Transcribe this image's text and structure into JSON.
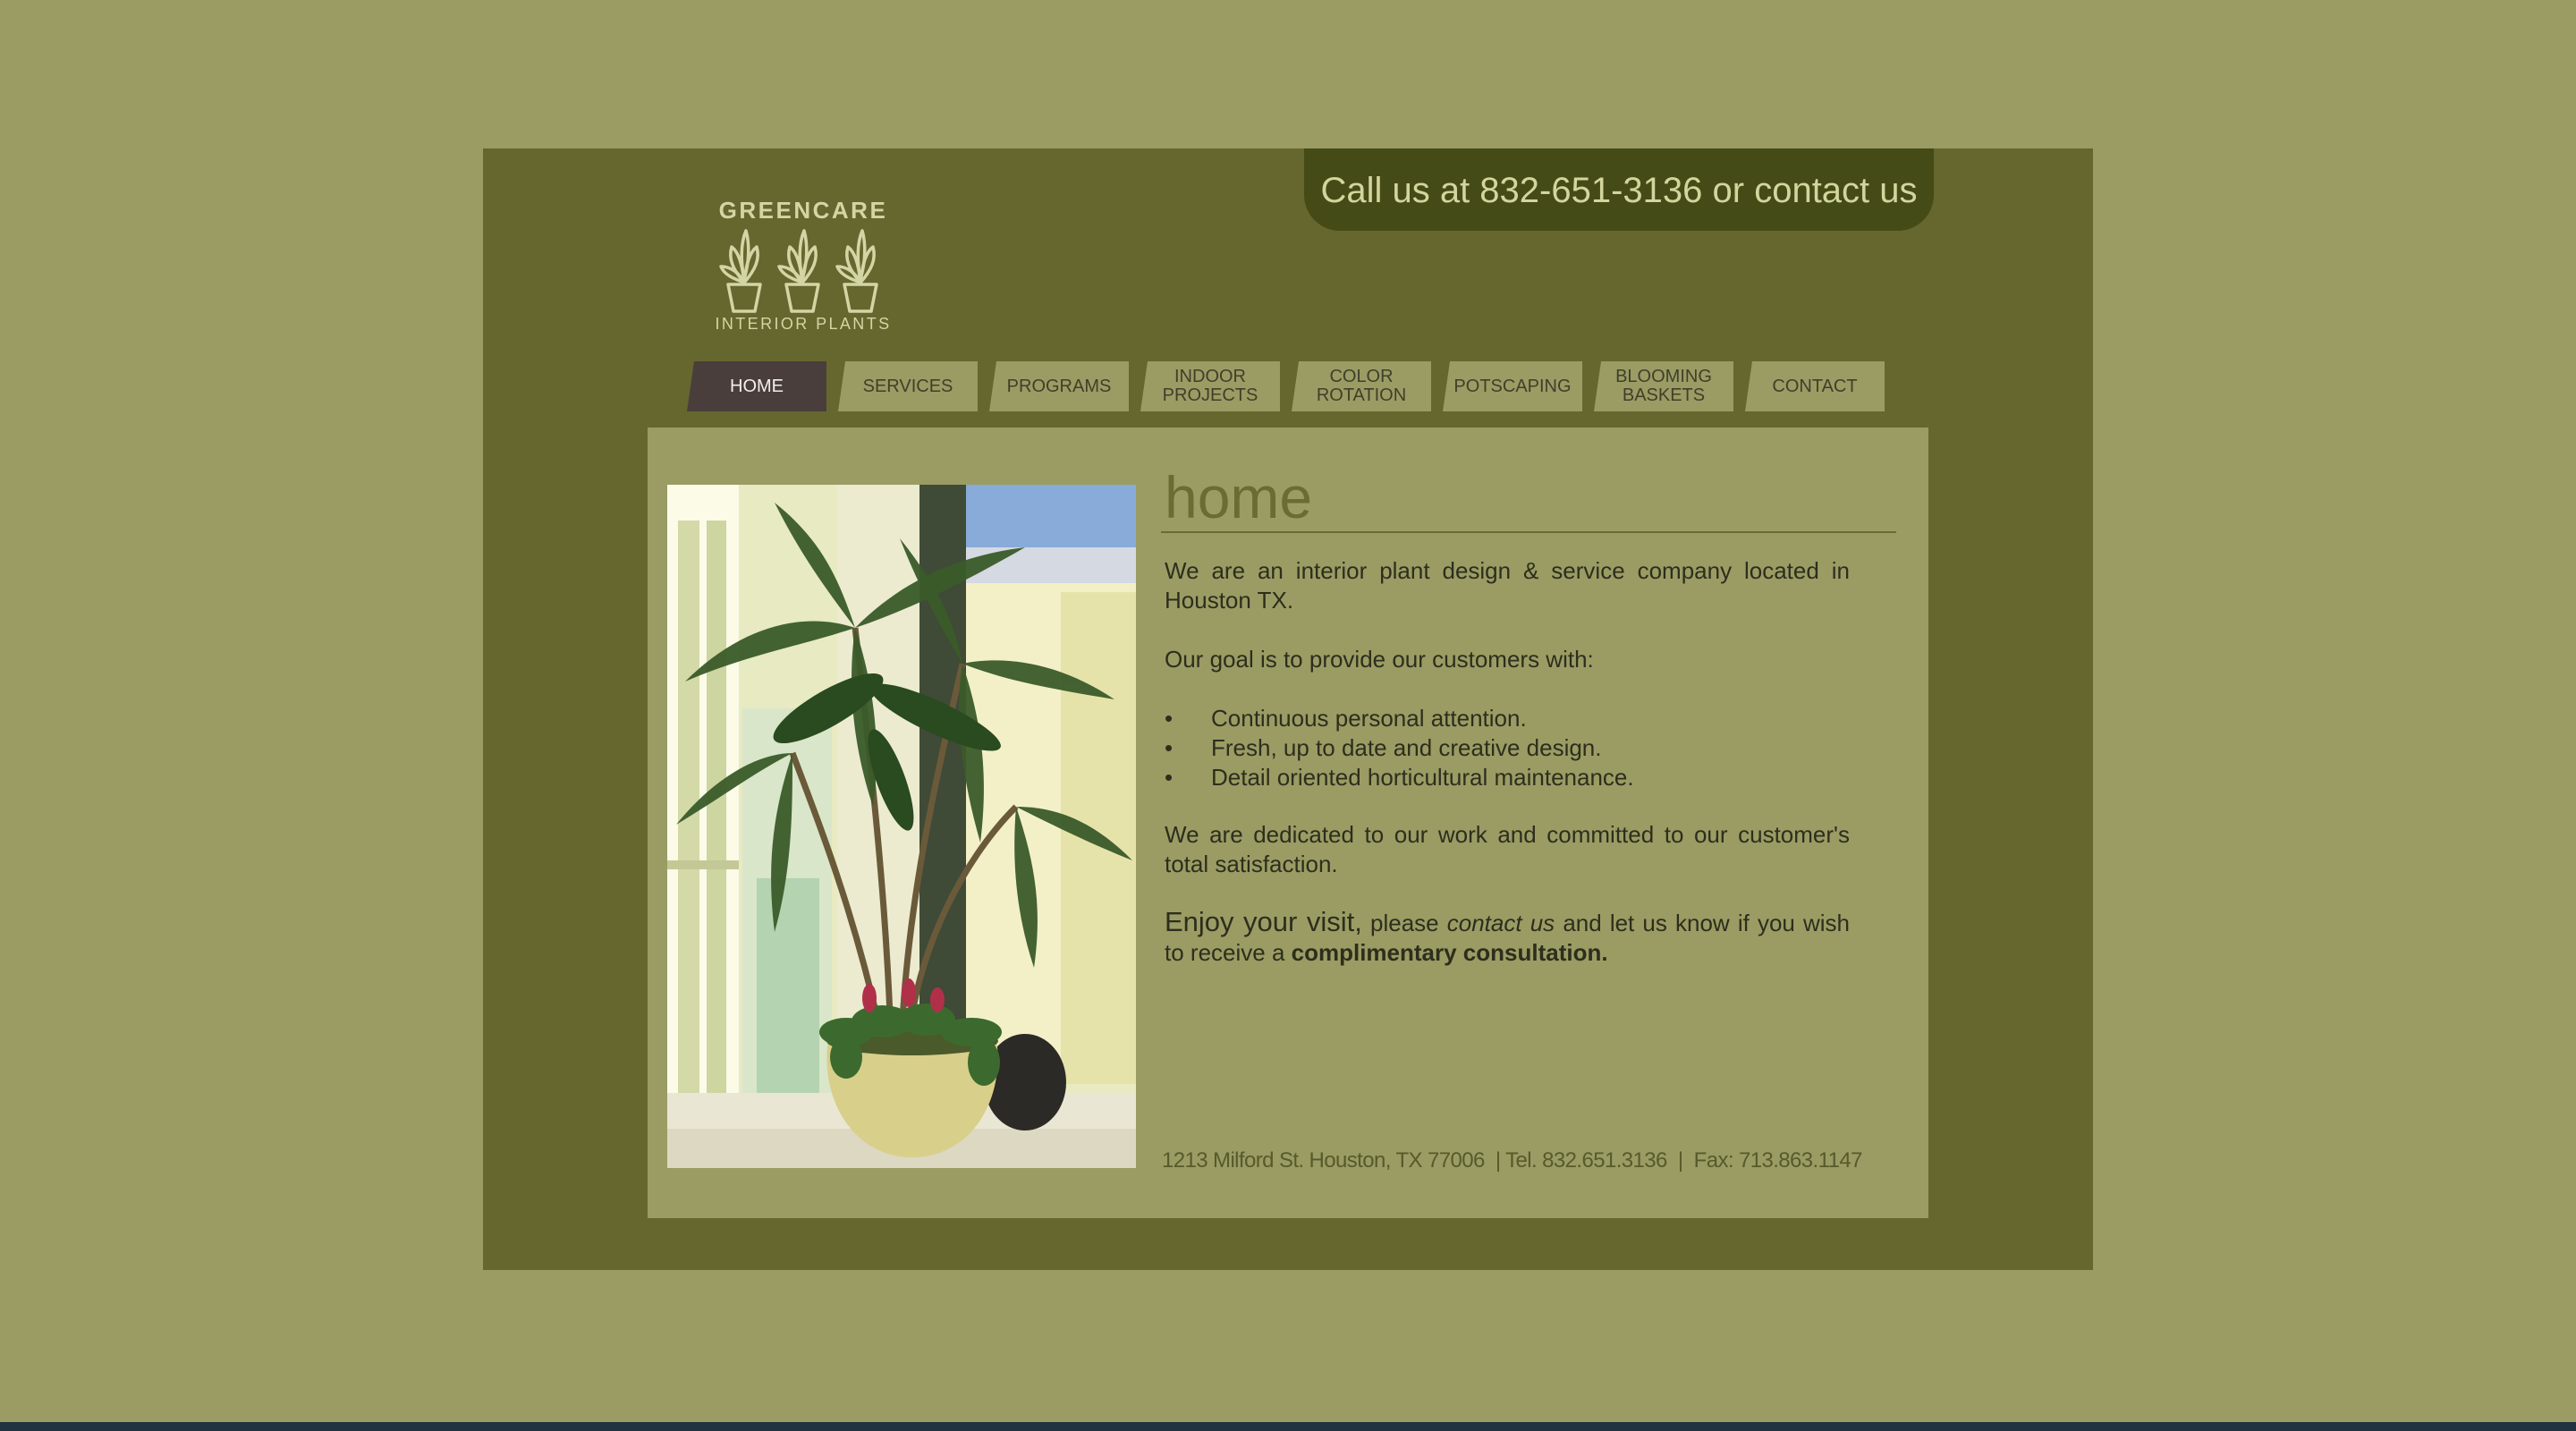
{
  "header": {
    "call_text": "Call us at 832-651-3136 or contact us",
    "logo_top": "GREENCARE",
    "logo_bottom": "INTERIOR PLANTS"
  },
  "nav": {
    "tabs": [
      {
        "label": "HOME",
        "active": true
      },
      {
        "label": "SERVICES"
      },
      {
        "label": "PROGRAMS"
      },
      {
        "label": "INDOOR\nPROJECTS"
      },
      {
        "label": "COLOR\nROTATION"
      },
      {
        "label": "POTSCAPING"
      },
      {
        "label": "BLOOMING\nBASKETS"
      },
      {
        "label": "CONTACT"
      }
    ]
  },
  "main": {
    "title": "home",
    "intro": "We are an interior plant design & service company located in Houston TX.",
    "goal": "Our goal is to provide our customers with:",
    "bullets": [
      "Continuous personal attention.",
      "Fresh, up to date and creative design.",
      "Detail oriented horticultural maintenance."
    ],
    "dedicated": "We are dedicated to our work and committed to our customer's total satisfaction.",
    "enjoy_big": "Enjoy your visit,",
    "enjoy_please": " please ",
    "contact_link": "contact us",
    "enjoy_rest": " and let us know if you wish to receive a ",
    "consultation": "complimentary consultation.",
    "footer": "1213 Milford St. Houston, TX 77006  | Tel. 832.651.3136  |  Fax: 713.863.1147"
  },
  "colors": {
    "page_bg": "#9a9c64",
    "frame_bg": "#65672f",
    "call_bar_bg": "#454b17",
    "active_tab": "#4a3e3c",
    "title_color": "#6a6c32"
  }
}
